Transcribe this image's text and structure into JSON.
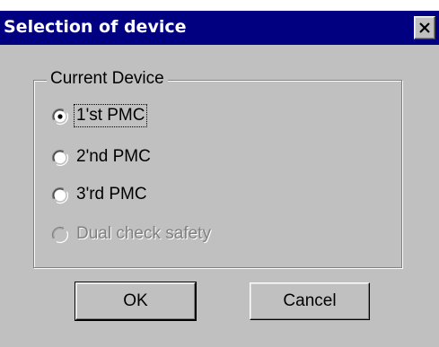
{
  "window": {
    "title": "Selection of device",
    "close_glyph": "✕"
  },
  "group": {
    "label": "Current Device",
    "options": [
      {
        "label": "1'st PMC",
        "selected": true,
        "enabled": true,
        "focused": true
      },
      {
        "label": "2'nd PMC",
        "selected": false,
        "enabled": true,
        "focused": false
      },
      {
        "label": "3'rd PMC",
        "selected": false,
        "enabled": true,
        "focused": false
      },
      {
        "label": "Dual check safety",
        "selected": false,
        "enabled": false,
        "focused": false
      }
    ]
  },
  "buttons": {
    "ok_label": "OK",
    "cancel_label": "Cancel"
  },
  "colors": {
    "titlebar": "#000080",
    "face": "#c0c0c0",
    "disabled_text": "#808080"
  }
}
